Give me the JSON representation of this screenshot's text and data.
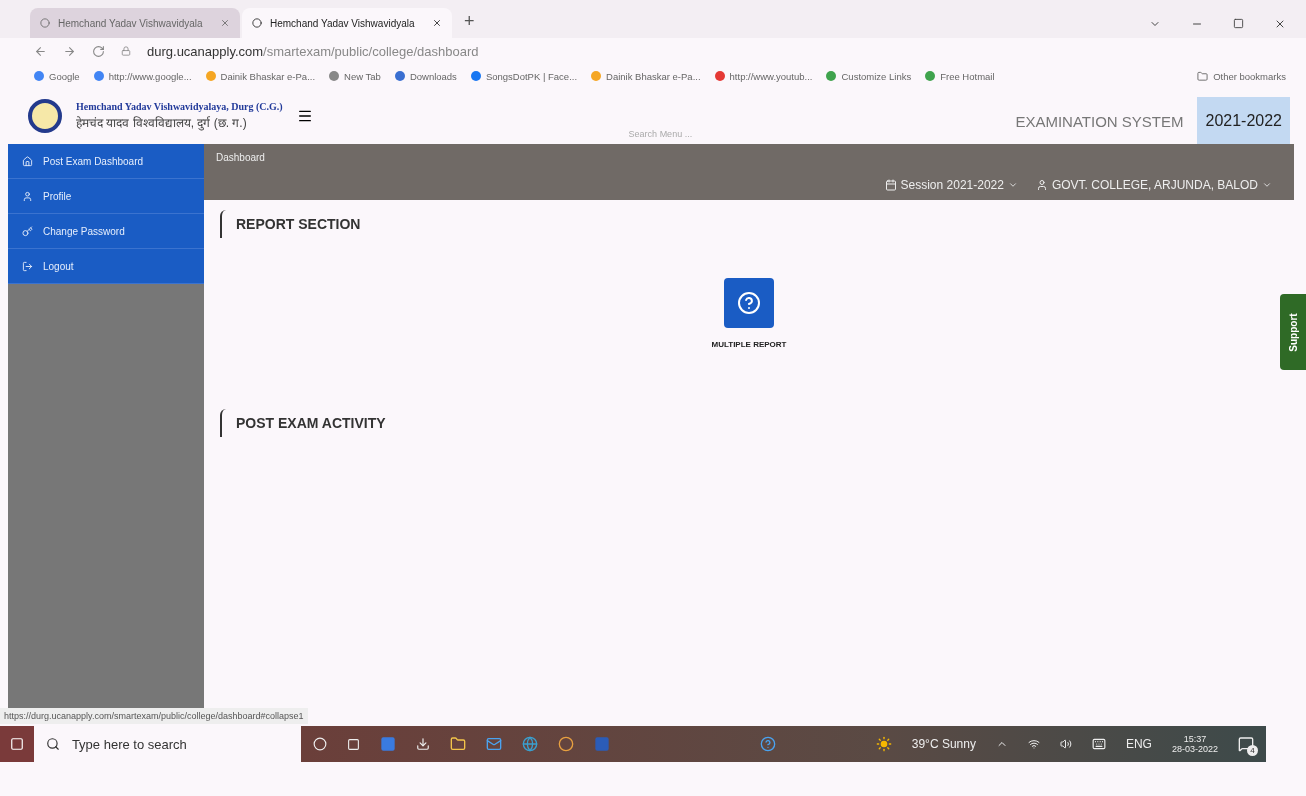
{
  "browser": {
    "tabs": [
      {
        "label": "Hemchand Yadav Vishwavidyala",
        "selected": false
      },
      {
        "label": "Hemchand Yadav Vishwavidyala",
        "selected": true
      }
    ],
    "new_tab": "+",
    "url": {
      "host": "durg.ucanapply.com",
      "path": "/smartexam/public/college/dashboard"
    },
    "bookmarks": [
      {
        "label": "Google"
      },
      {
        "label": "http://www.google..."
      },
      {
        "label": "Dainik Bhaskar e-Pa..."
      },
      {
        "label": "New Tab"
      },
      {
        "label": "Downloads"
      },
      {
        "label": "SongsDotPK | Face..."
      },
      {
        "label": "Dainik Bhaskar e-Pa..."
      },
      {
        "label": "http://www.youtub..."
      },
      {
        "label": "Customize Links"
      },
      {
        "label": "Free Hotmail"
      }
    ],
    "other_bookmarks": "Other bookmarks"
  },
  "header": {
    "university_en": "Hemchand Yadav Vishwavidyalaya, Durg (C.G.)",
    "university_hi": "हेमचंद यादव विश्वविद्यालय, दुर्ग (छ. ग.)",
    "search_placeholder": "Search Menu ...",
    "system": "EXAMINATION SYSTEM",
    "year": "2021-2022"
  },
  "sidebar": {
    "items": [
      {
        "label": "Post Exam Dashboard"
      },
      {
        "label": "Profile"
      },
      {
        "label": "Change Password"
      },
      {
        "label": "Logout"
      }
    ]
  },
  "topbar": {
    "breadcrumb": "Dashboard",
    "session": "Session  2021-2022",
    "college": "GOVT. COLLEGE, ARJUNDA, BALOD"
  },
  "sections": [
    {
      "title": "REPORT SECTION",
      "tiles": [
        {
          "label": "MULTIPLE REPORT"
        }
      ]
    },
    {
      "title": "POST EXAM ACTIVITY"
    }
  ],
  "support": "Support",
  "status_url": "https://durg.ucanapply.com/smartexam/public/college/dashboard#collapse1",
  "taskbar": {
    "search_placeholder": "Type here to search",
    "weather": "39°C  Sunny",
    "language": "ENG",
    "time": "15:37",
    "date": "28-03-2022",
    "notifications": "4"
  }
}
